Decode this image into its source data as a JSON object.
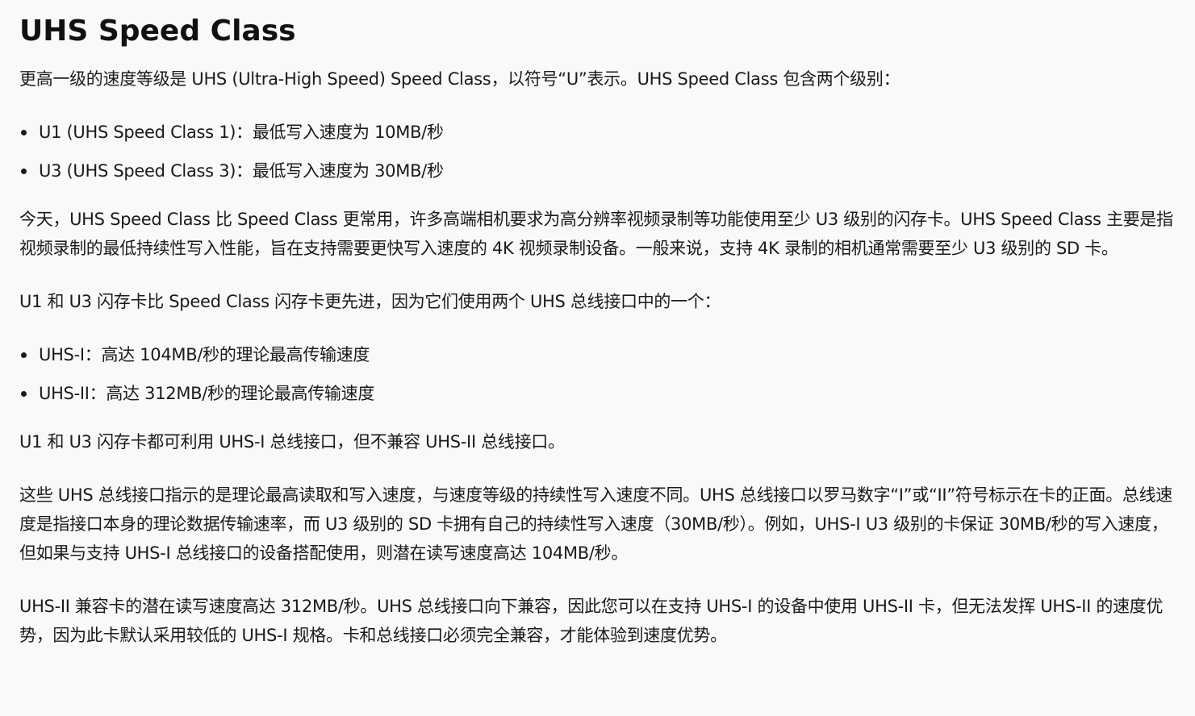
{
  "title": "UHS Speed Class",
  "intro": "更高一级的速度等级是 UHS (Ultra-High Speed) Speed Class，以符号“U”表示。UHS Speed Class 包含两个级别：",
  "speed_levels": [
    "U1 (UHS Speed Class 1)：最低写入速度为 10MB/秒",
    "U3 (UHS Speed Class 3)：最低写入速度为 30MB/秒"
  ],
  "today_paragraph": "今天，UHS Speed Class 比 Speed Class 更常用，许多高端相机要求为高分辨率视频录制等功能使用至少 U3 级别的闪存卡。UHS Speed Class 主要是指视频录制的最低持续性写入性能，旨在支持需要更快写入速度的 4K 视频录制设备。一般来说，支持 4K 录制的相机通常需要至少 U3 级别的 SD 卡。",
  "advanced_paragraph": "U1 和 U3 闪存卡比 Speed Class 闪存卡更先进，因为它们使用两个 UHS 总线接口中的一个：",
  "bus_interfaces": [
    "UHS-I：高达 104MB/秒的理论最高传输速度",
    "UHS-II：高达 312MB/秒的理论最高传输速度"
  ],
  "compat_paragraph": "U1 和 U3 闪存卡都可利用 UHS-I 总线接口，但不兼容 UHS-II 总线接口。",
  "bus_paragraph": "这些 UHS 总线接口指示的是理论最高读取和写入速度，与速度等级的持续性写入速度不同。UHS 总线接口以罗马数字“I”或“II”符号标示在卡的正面。总线速度是指接口本身的理论数据传输速率，而 U3 级别的 SD 卡拥有自己的持续性写入速度（30MB/秒）。例如，UHS-I U3 级别的卡保证 30MB/秒的写入速度，但如果与支持 UHS-I 总线接口的设备搭配使用，则潜在读写速度高达 104MB/秒。",
  "uhs2_paragraph": "UHS-II 兼容卡的潜在读写速度高达 312MB/秒。UHS 总线接口向下兼容，因此您可以在支持 UHS-I 的设备中使用 UHS-II 卡，但无法发挥 UHS-II 的速度优势，因为此卡默认采用较低的 UHS-I 规格。卡和总线接口必须完全兼容，才能体验到速度优势。"
}
